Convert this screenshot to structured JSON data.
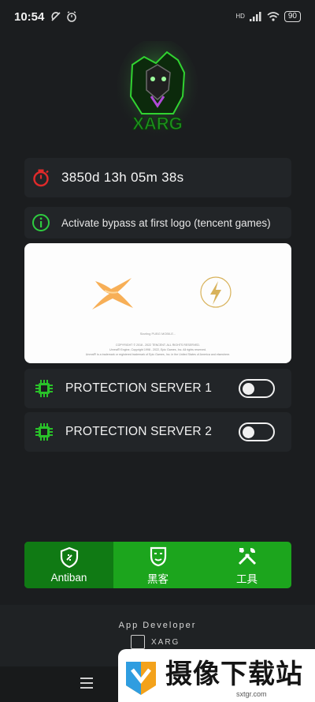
{
  "status_bar": {
    "time": "10:54",
    "signal": "HD",
    "battery": "90"
  },
  "timer": {
    "text": "3850d 13h 05m 38s",
    "icon": "stopwatch-icon"
  },
  "info": {
    "text": "Activate bypass at first logo (tencent games)",
    "icon": "info-circle-icon"
  },
  "preview": {
    "loading": "Starting PUBG MOBILE...",
    "copy_lines": [
      "COPYRIGHT © 2018 - 2022 TENCENT. ALL RIGHTS RESERVED.",
      "Unreal® Engine, Copyright 1998 - 2022, Epic Games, Inc. All rights reserved.",
      "Unreal® is a trademark or registered trademark of Epic Games, Inc. in the United States of America and elsewhere."
    ]
  },
  "servers": [
    {
      "label": "PROTECTION SERVER 1",
      "enabled": false
    },
    {
      "label": "PROTECTION SERVER 2",
      "enabled": false
    }
  ],
  "tabs": [
    {
      "label": "Antiban",
      "icon": "shield-icon",
      "active": true
    },
    {
      "label": "黑客",
      "icon": "mask-icon",
      "active": false
    },
    {
      "label": "工具",
      "icon": "tools-icon",
      "active": false
    }
  ],
  "developer": {
    "title": "App Developer",
    "name": "XARG"
  },
  "watermark": {
    "text": "摄像下载站",
    "sub": "sxtgr.com"
  },
  "colors": {
    "accent_green": "#1ca51d",
    "active_green": "#107a14",
    "timer_red": "#e02a2a",
    "info_green": "#2ecc40"
  }
}
